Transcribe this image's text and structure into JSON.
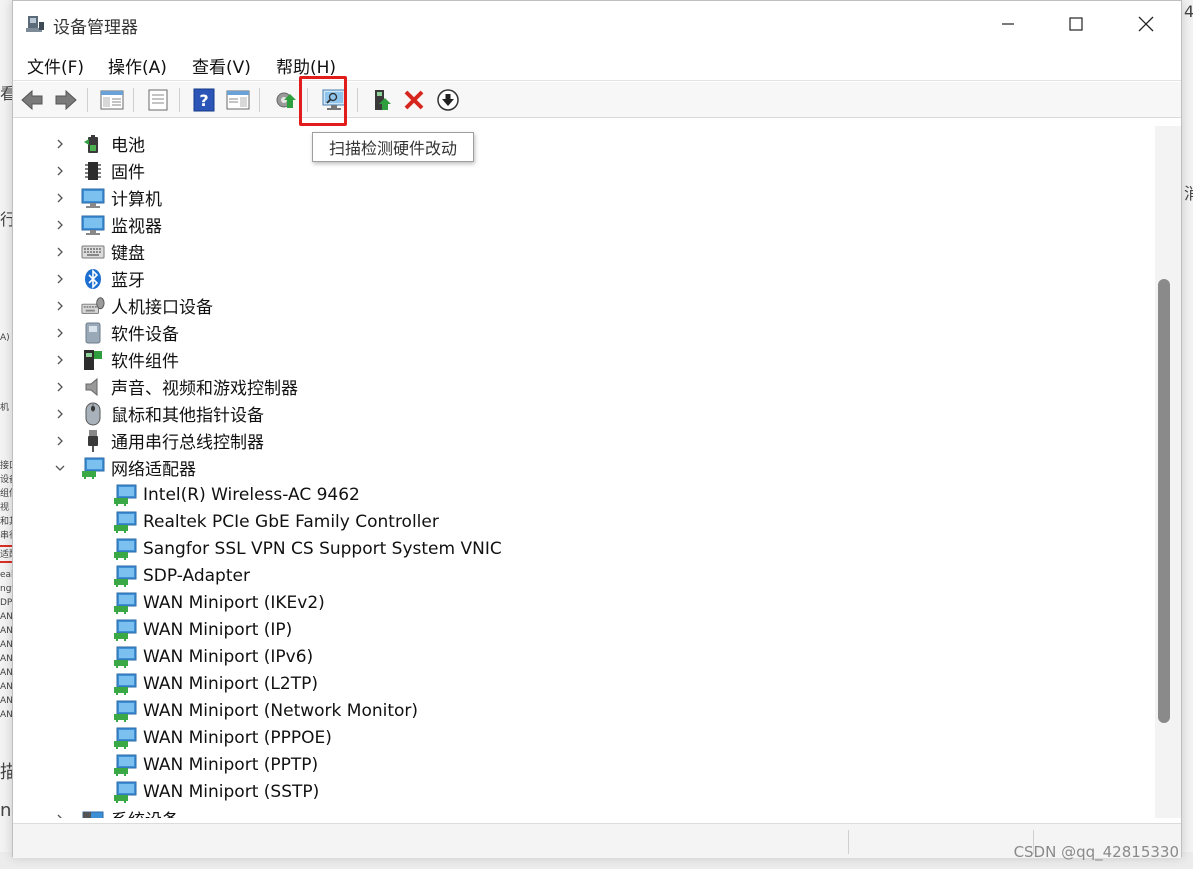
{
  "window": {
    "title": "设备管理器"
  },
  "menu": [
    "文件(F)",
    "操作(A)",
    "查看(V)",
    "帮助(H)"
  ],
  "toolbar": {
    "buttons": [
      "back-icon",
      "forward-icon",
      "show-hide-tree-icon",
      "properties-icon",
      "help-icon",
      "action-pane-icon",
      "update-driver-icon",
      "scan-hardware-icon",
      "enable-device-icon",
      "uninstall-icon",
      "download-icon"
    ],
    "tooltip": "扫描检测硬件改动"
  },
  "tree": {
    "categories": [
      {
        "label": "电池",
        "icon": "battery-icon"
      },
      {
        "label": "固件",
        "icon": "firmware-icon"
      },
      {
        "label": "计算机",
        "icon": "computer-icon"
      },
      {
        "label": "监视器",
        "icon": "monitor-icon"
      },
      {
        "label": "键盘",
        "icon": "keyboard-icon"
      },
      {
        "label": "蓝牙",
        "icon": "bluetooth-icon"
      },
      {
        "label": "人机接口设备",
        "icon": "hid-icon"
      },
      {
        "label": "软件设备",
        "icon": "software-device-icon"
      },
      {
        "label": "软件组件",
        "icon": "software-component-icon"
      },
      {
        "label": "声音、视频和游戏控制器",
        "icon": "sound-icon"
      },
      {
        "label": "鼠标和其他指针设备",
        "icon": "mouse-icon"
      },
      {
        "label": "通用串行总线控制器",
        "icon": "usb-icon"
      },
      {
        "label": "网络适配器",
        "icon": "network-adapter-icon"
      }
    ],
    "network_adapters": [
      "Intel(R) Wireless-AC 9462",
      "Realtek PCIe GbE Family Controller",
      "Sangfor SSL VPN CS Support System VNIC",
      "SDP-Adapter",
      "WAN Miniport (IKEv2)",
      "WAN Miniport (IP)",
      "WAN Miniport (IPv6)",
      "WAN Miniport (L2TP)",
      "WAN Miniport (Network Monitor)",
      "WAN Miniport (PPPOE)",
      "WAN Miniport (PPTP)",
      "WAN Miniport (SSTP)"
    ],
    "last_category": "系统设备"
  },
  "watermark": "CSDN @qq_42815330"
}
